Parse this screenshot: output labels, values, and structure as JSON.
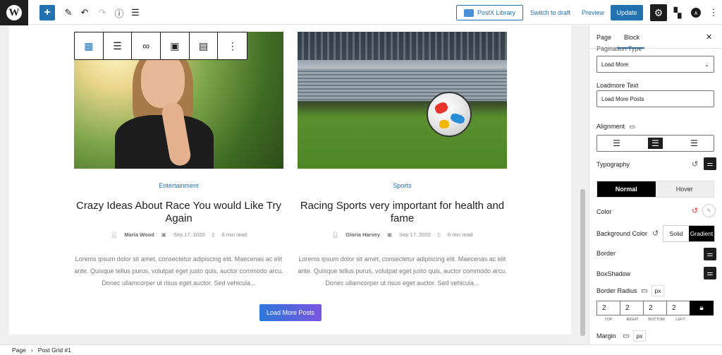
{
  "topbar": {
    "postx_library": "PostX Library",
    "switch_to_draft": "Switch to draft",
    "preview": "Preview",
    "update": "Update"
  },
  "posts": [
    {
      "category": "Entertainment",
      "title": "Crazy Ideas About Race You would Like Try Again",
      "author": "Maria Wood",
      "date": "Sep 17, 2020",
      "read_time": "6 min read",
      "excerpt": "Lorems ipsum dolor sit amet, consectetur adipiscing elit. Maecenas ac elit ante. Quisque tellus purus, volutpat eget justo quis, auctor commodo arcu. Donec ullamcorper ut risus eget auctor. Sed vehicula..."
    },
    {
      "category": "Sports",
      "title": "Racing Sports very important for health and fame",
      "author": "Gloria Harvey",
      "date": "Sep 17, 2020",
      "read_time": "6 min read",
      "excerpt": "Lorems ipsum dolor sit amet, consectetur adipiscing elit. Maecenas ac elit ante. Quisque tellus purus, volutpat eget justo quis, auctor commodo arcu. Donec ullamcorper ut risus eget auctor. Sed vehicula..."
    }
  ],
  "load_more_button": "Load More Posts",
  "footer": {
    "crumb_page": "Page",
    "crumb_block": "Post Grid #1"
  },
  "sidebar": {
    "tab_page": "Page",
    "tab_block": "Block",
    "pagination_type_label": "Pagination Type",
    "pagination_type_value": "Load More",
    "loadmore_text_label": "Loadmore Text",
    "loadmore_text_value": "Load More Posts",
    "alignment_label": "Alignment",
    "typography_label": "Typography",
    "normal": "Normal",
    "hover": "Hover",
    "color_label": "Color",
    "background_color_label": "Background Color",
    "solid": "Solid",
    "gradient": "Gradient",
    "border_label": "Border",
    "boxshadow_label": "BoxShadow",
    "border_radius_label": "Border Radius",
    "unit_px": "px",
    "radius_values": [
      "2",
      "2",
      "2",
      "2"
    ],
    "radius_sides": [
      "TOP",
      "RIGHT",
      "BOTTOM",
      "LEFT"
    ],
    "margin_label": "Margin"
  },
  "colors": {
    "accent": "#2271b1",
    "loadmore_gradient_start": "#2b77d8",
    "loadmore_gradient_end": "#7a55e0",
    "dark": "#1e1e1e"
  }
}
